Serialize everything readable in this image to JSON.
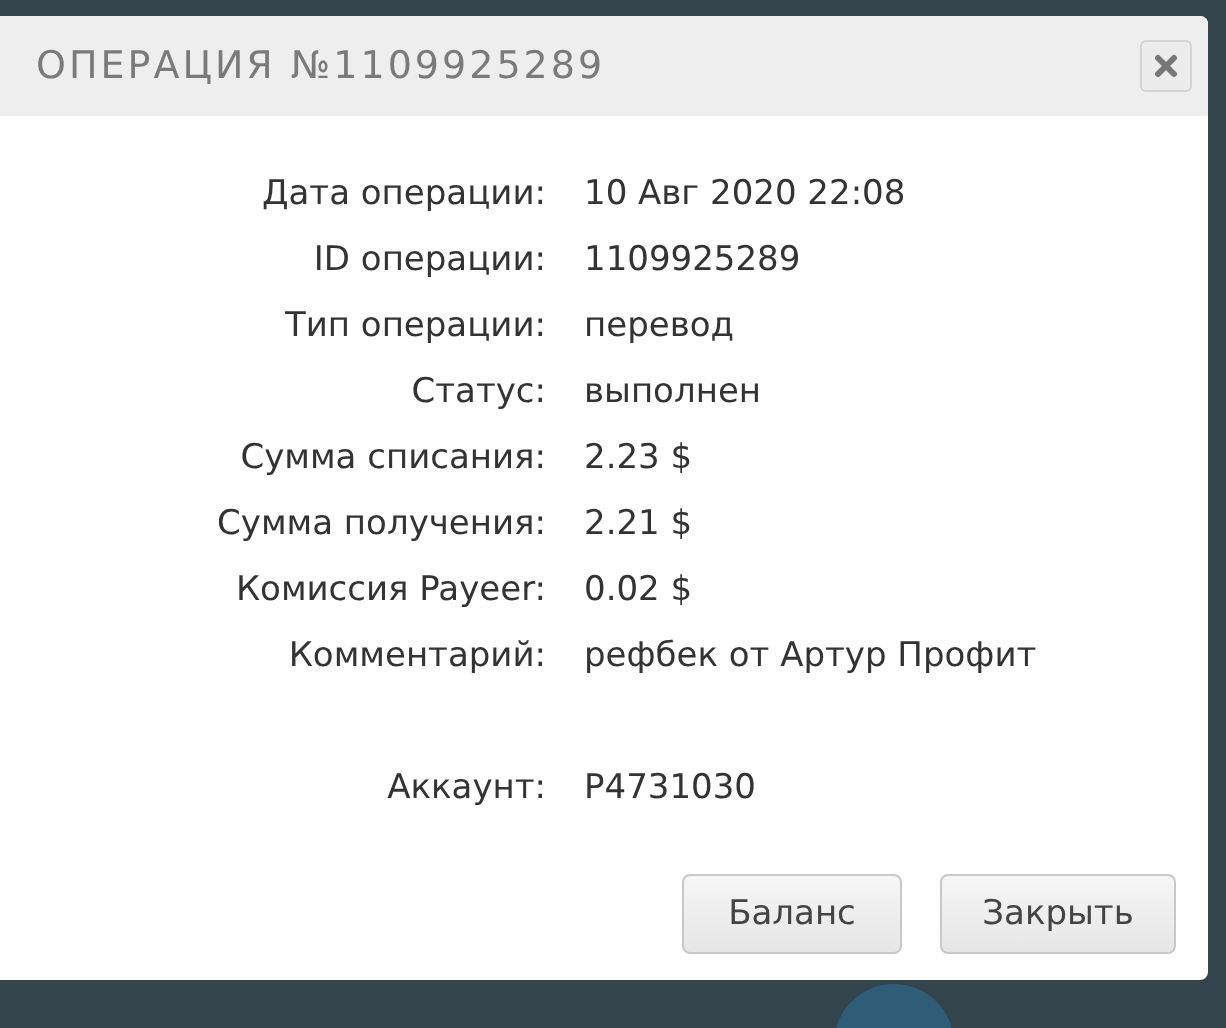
{
  "dialog": {
    "title": "ОПЕРАЦИЯ №1109925289",
    "fields": [
      {
        "label": "Дата операции:",
        "value": "10 Авг 2020 22:08"
      },
      {
        "label": "ID операции:",
        "value": "1109925289"
      },
      {
        "label": "Тип операции:",
        "value": "перевод"
      },
      {
        "label": "Статус:",
        "value": "выполнен"
      },
      {
        "label": "Сумма списания:",
        "value": "2.23 $"
      },
      {
        "label": "Сумма получения:",
        "value": "2.21 $"
      },
      {
        "label": "Комиссия Payeer:",
        "value": "0.02 $"
      },
      {
        "label": "Комментарий:",
        "value": "рефбек от Артур Профит"
      }
    ],
    "account": {
      "label": "Аккаунт:",
      "value": "P4731030"
    },
    "buttons": [
      "Баланс",
      "Закрыть"
    ]
  }
}
